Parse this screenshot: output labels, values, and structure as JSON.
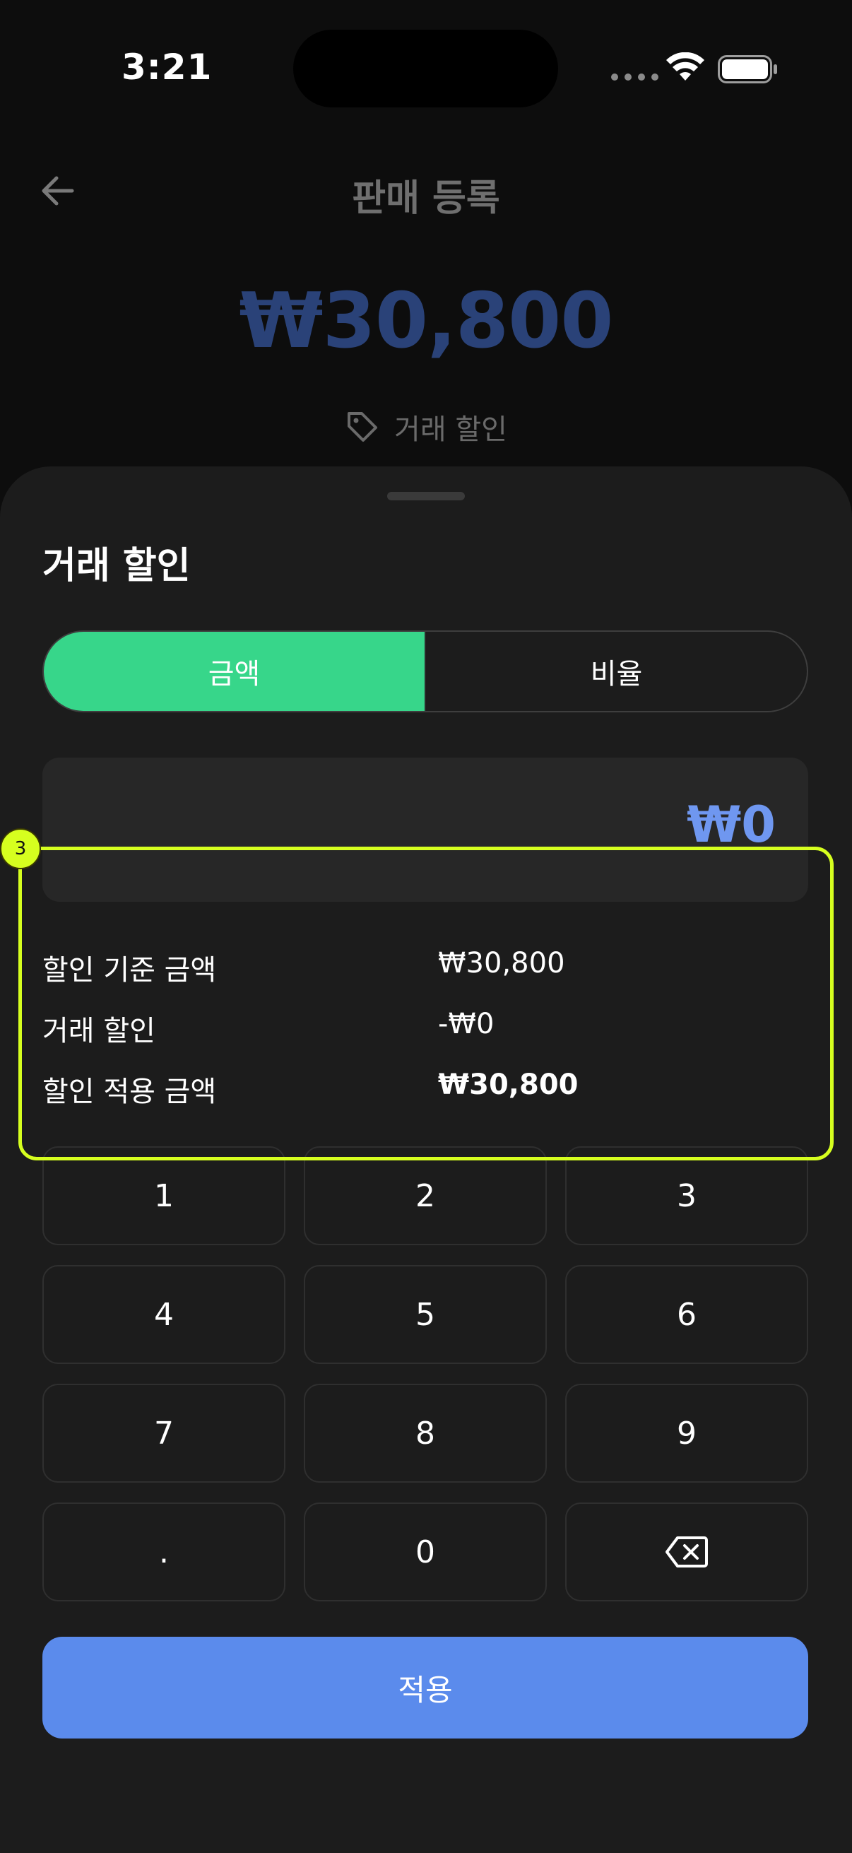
{
  "status_bar": {
    "time": "3:21"
  },
  "header": {
    "title": "판매 등록"
  },
  "sale": {
    "total": "₩30,800",
    "discount_link": "거래 할인"
  },
  "sheet": {
    "title": "거래 할인",
    "tabs": [
      {
        "label": "금액",
        "selected": true
      },
      {
        "label": "비율",
        "selected": false
      }
    ],
    "input_value": "₩0",
    "summary": [
      {
        "label": "할인 기준 금액",
        "value": "₩30,800"
      },
      {
        "label": "거래 할인",
        "value": "-₩0"
      },
      {
        "label": "할인 적용 금액",
        "value": "₩30,800"
      }
    ],
    "highlight_badge": "3",
    "keypad": [
      "1",
      "2",
      "3",
      "4",
      "5",
      "6",
      "7",
      "8",
      "9",
      ".",
      "0"
    ],
    "apply_label": "적용"
  },
  "colors": {
    "accent_green": "#37d68a",
    "accent_blue": "#5b8bec",
    "highlight": "#d6ff1f",
    "sheet_bg": "#1c1c1c"
  }
}
